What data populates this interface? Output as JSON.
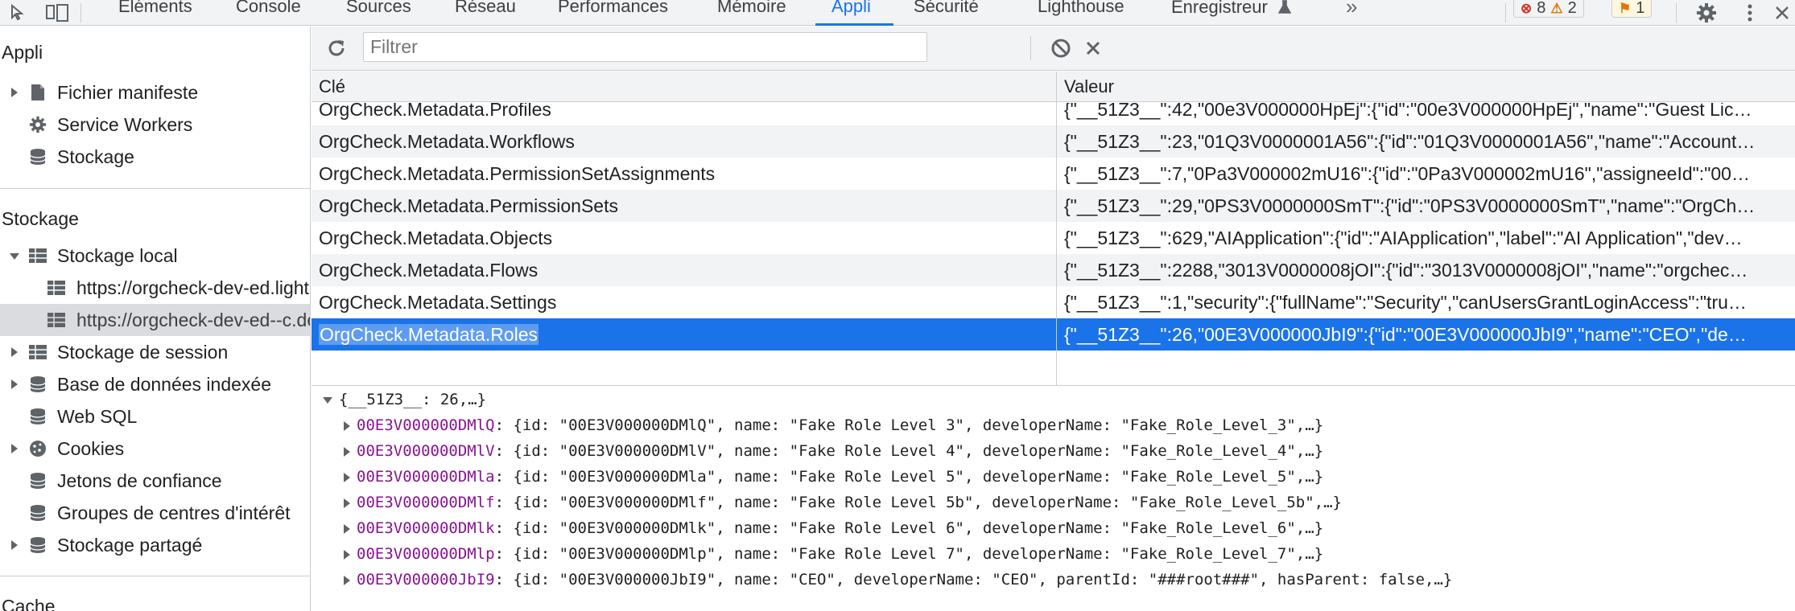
{
  "toolbar": {
    "tabs": [
      "Éléments",
      "Console",
      "Sources",
      "Réseau",
      "Performances",
      "Mémoire",
      "Appli",
      "Sécurité",
      "Lighthouse",
      "Enregistreur"
    ],
    "more_label": "»",
    "errors_count": "8",
    "warnings_count": "2",
    "issues_count": "1"
  },
  "sidebar": {
    "app_section_title": "Appli",
    "app_items": [
      "Fichier manifeste",
      "Service Workers",
      "Stockage"
    ],
    "storage_section_title": "Stockage",
    "local_storage_label": "Stockage local",
    "local_storage_origins": [
      "https://orgcheck-dev-ed.lightning.force.com",
      "https://orgcheck-dev-ed--c.develop.vf.force.com"
    ],
    "storage_items": [
      "Stockage de session",
      "Base de données indexée",
      "Web SQL",
      "Cookies",
      "Jetons de confiance",
      "Groupes de centres d'intérêt",
      "Stockage partagé"
    ],
    "cache_section_title": "Cache"
  },
  "filter": {
    "placeholder": "Filtrer"
  },
  "table": {
    "key_header": "Clé",
    "value_header": "Valeur",
    "rows": [
      {
        "key": "OrgCheck.Metadata.Profiles",
        "value": "{\"__51Z3__\":42,\"00e3V000000HpEj\":{\"id\":\"00e3V000000HpEj\",\"name\":\"Guest Lic…"
      },
      {
        "key": "OrgCheck.Metadata.Workflows",
        "value": "{\"__51Z3__\":23,\"01Q3V0000001A56\":{\"id\":\"01Q3V0000001A56\",\"name\":\"Account…"
      },
      {
        "key": "OrgCheck.Metadata.PermissionSetAssignments",
        "value": "{\"__51Z3__\":7,\"0Pa3V000002mU16\":{\"id\":\"0Pa3V000002mU16\",\"assigneeId\":\"00…"
      },
      {
        "key": "OrgCheck.Metadata.PermissionSets",
        "value": "{\"__51Z3__\":29,\"0PS3V0000000SmT\":{\"id\":\"0PS3V0000000SmT\",\"name\":\"OrgCh…"
      },
      {
        "key": "OrgCheck.Metadata.Objects",
        "value": "{\"__51Z3__\":629,\"AIApplication\":{\"id\":\"AIApplication\",\"label\":\"AI Application\",\"dev…"
      },
      {
        "key": "OrgCheck.Metadata.Flows",
        "value": "{\"__51Z3__\":2288,\"3013V0000008jOI\":{\"id\":\"3013V0000008jOI\",\"name\":\"orgchec…"
      },
      {
        "key": "OrgCheck.Metadata.Settings",
        "value": "{\"__51Z3__\":1,\"security\":{\"fullName\":\"Security\",\"canUsersGrantLoginAccess\":\"tru…"
      },
      {
        "key": "OrgCheck.Metadata.Roles",
        "value": "{\"__51Z3__\":26,\"00E3V000000JbI9\":{\"id\":\"00E3V000000JbI9\",\"name\":\"CEO\",\"de…"
      }
    ]
  },
  "preview": {
    "root": "{__51Z3__: 26,…}",
    "entries": [
      {
        "key": "00E3V000000DMlQ",
        "value": ": {id: \"00E3V000000DMlQ\", name: \"Fake Role Level 3\", developerName: \"Fake_Role_Level_3\",…}"
      },
      {
        "key": "00E3V000000DMlV",
        "value": ": {id: \"00E3V000000DMlV\", name: \"Fake Role Level 4\", developerName: \"Fake_Role_Level_4\",…}"
      },
      {
        "key": "00E3V000000DMla",
        "value": ": {id: \"00E3V000000DMla\", name: \"Fake Role Level 5\", developerName: \"Fake_Role_Level_5\",…}"
      },
      {
        "key": "00E3V000000DMlf",
        "value": ": {id: \"00E3V000000DMlf\", name: \"Fake Role Level 5b\", developerName: \"Fake_Role_Level_5b\",…}"
      },
      {
        "key": "00E3V000000DMlk",
        "value": ": {id: \"00E3V000000DMlk\", name: \"Fake Role Level 6\", developerName: \"Fake_Role_Level_6\",…}"
      },
      {
        "key": "00E3V000000DMlp",
        "value": ": {id: \"00E3V000000DMlp\", name: \"Fake Role Level 7\", developerName: \"Fake_Role_Level_7\",…}"
      },
      {
        "key": "00E3V000000JbI9",
        "value": ": {id: \"00E3V000000JbI9\", name: \"CEO\", developerName: \"CEO\", parentId: \"###root###\", hasParent: false,…}"
      }
    ]
  },
  "icons": {
    "inspect": "cursor-arrow-icon",
    "device": "device-toggle-icon",
    "settings": "gear-icon",
    "menu": "kebab-menu-icon",
    "close": "close-icon",
    "refresh": "refresh-icon",
    "clear_all": "block-icon",
    "delete": "x-icon",
    "file": "file-icon",
    "gear": "gear-icon",
    "database": "database-icon",
    "grid": "grid-icon",
    "cookie": "cookie-icon"
  },
  "colors": {
    "accent": "#1a73e8",
    "selection": "#1a73e8",
    "key_purple": "#881391",
    "error_red": "#d93025",
    "warning_orange": "#e37400"
  }
}
